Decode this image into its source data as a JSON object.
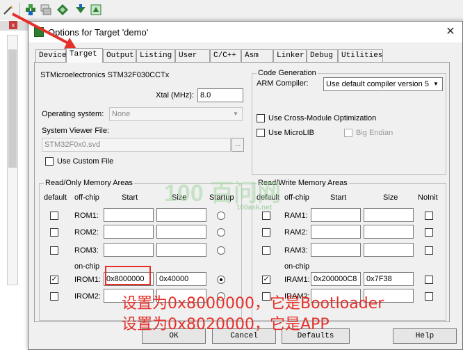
{
  "toolbar": {
    "icons": [
      "magic-wand-icon",
      "load-icon",
      "stack-icon",
      "green-diamond-icon",
      "download-arrow-icon",
      "map-icon"
    ]
  },
  "dialog": {
    "title": "Options for Target 'demo'",
    "close_glyph": "✕",
    "tabs": [
      "Device",
      "Target",
      "Output",
      "Listing",
      "User",
      "C/C++",
      "Asm",
      "Linker",
      "Debug",
      "Utilities"
    ],
    "active_tab": "Target",
    "device_name": "STMicroelectronics STM32F030CCTx",
    "xtal_label": "Xtal (MHz):",
    "xtal_value": "8.0",
    "os_label": "Operating system:",
    "os_value": "None",
    "svf_label": "System Viewer File:",
    "svf_value": "STM32F0x0.svd",
    "custom_file_label": "Use Custom File",
    "codegen": {
      "title": "Code Generation",
      "arm_compiler_label": "ARM Compiler:",
      "arm_compiler_value": "Use default compiler version 5",
      "cross_module_label": "Use Cross-Module Optimization",
      "microlib_label": "Use MicroLIB",
      "big_endian_label": "Big Endian"
    },
    "ro": {
      "title": "Read/Only Memory Areas",
      "h_default": "default",
      "h_offchip": "off-chip",
      "h_start": "Start",
      "h_size": "Size",
      "h_startup": "Startup",
      "onchip_label": "on-chip",
      "rows": [
        {
          "name": "ROM1:",
          "start": "",
          "size": "",
          "default": false,
          "startup": false
        },
        {
          "name": "ROM2:",
          "start": "",
          "size": "",
          "default": false,
          "startup": false
        },
        {
          "name": "ROM3:",
          "start": "",
          "size": "",
          "default": false,
          "startup": false
        },
        {
          "name": "IROM1:",
          "start": "0x8000000",
          "size": "0x40000",
          "default": true,
          "startup": true
        },
        {
          "name": "IROM2:",
          "start": "",
          "size": "",
          "default": false,
          "startup": false
        }
      ]
    },
    "rw": {
      "title": "Read/Write Memory Areas",
      "h_default": "default",
      "h_offchip": "off-chip",
      "h_start": "Start",
      "h_size": "Size",
      "h_noinit": "NoInit",
      "onchip_label": "on-chip",
      "rows": [
        {
          "name": "RAM1:",
          "start": "",
          "size": ""
        },
        {
          "name": "RAM2:",
          "start": "",
          "size": ""
        },
        {
          "name": "RAM3:",
          "start": "",
          "size": ""
        },
        {
          "name": "IRAM1:",
          "start": "0x200000C8",
          "size": "0x7F38",
          "default": true
        },
        {
          "name": "IRAM2:",
          "start": "",
          "size": ""
        }
      ]
    },
    "buttons": {
      "ok": "OK",
      "cancel": "Cancel",
      "defaults": "Defaults",
      "help": "Help"
    }
  },
  "annotations": {
    "line1": "设置为0x8000000，它是Bootloader",
    "line2": "设置为0x8020000，它是APP",
    "color": "#e5302a"
  },
  "watermark": {
    "brand": "100ask.net",
    "logo_text": "100 百问网"
  },
  "left_pane": {
    "close_glyph": "x"
  }
}
